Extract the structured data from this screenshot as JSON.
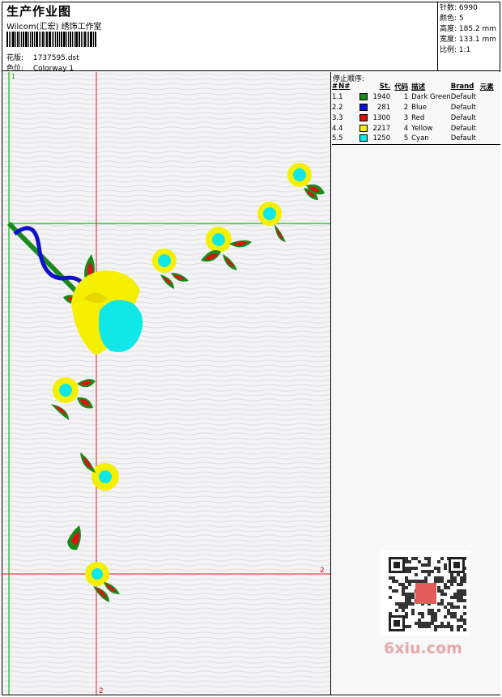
{
  "header": {
    "title": "生产作业图",
    "company": "Wilcom(汇宏) 绣饰工作室",
    "design_label": "花版:",
    "design_value": "1737595.dst",
    "colorway_label": "色位:",
    "colorway_value": "Colorway 1"
  },
  "stats": {
    "stitches": "针数: 6990",
    "colors": "颜色: 5",
    "height": "高度: 185.2 mm",
    "width": "宽度: 133.1 mm",
    "scale": "比例: 1:1"
  },
  "canvas_marks": {
    "top_marker": "1",
    "right_marker": "2",
    "bottom_marker": "2"
  },
  "color_table": {
    "title": "停止顺序:",
    "headers": [
      "#",
      "N#",
      "St.",
      "代码",
      "描述",
      "Brand",
      "元素"
    ],
    "rows": [
      {
        "num": "1.",
        "n": "1",
        "color": "#1a8a1a",
        "st": "1940",
        "code": "1",
        "desc": "Dark Green",
        "brand": "Default"
      },
      {
        "num": "2.",
        "n": "2",
        "color": "#1010d0",
        "st": "281",
        "code": "2",
        "desc": "Blue",
        "brand": "Default"
      },
      {
        "num": "3.",
        "n": "3",
        "color": "#e01010",
        "st": "1300",
        "code": "3",
        "desc": "Red",
        "brand": "Default"
      },
      {
        "num": "4.",
        "n": "4",
        "color": "#f5f000",
        "st": "2217",
        "code": "4",
        "desc": "Yellow",
        "brand": "Default"
      },
      {
        "num": "5.",
        "n": "5",
        "color": "#10e8e8",
        "st": "1250",
        "code": "5",
        "desc": "Cyan",
        "brand": "Default"
      }
    ]
  },
  "watermark": "6xiu.com"
}
